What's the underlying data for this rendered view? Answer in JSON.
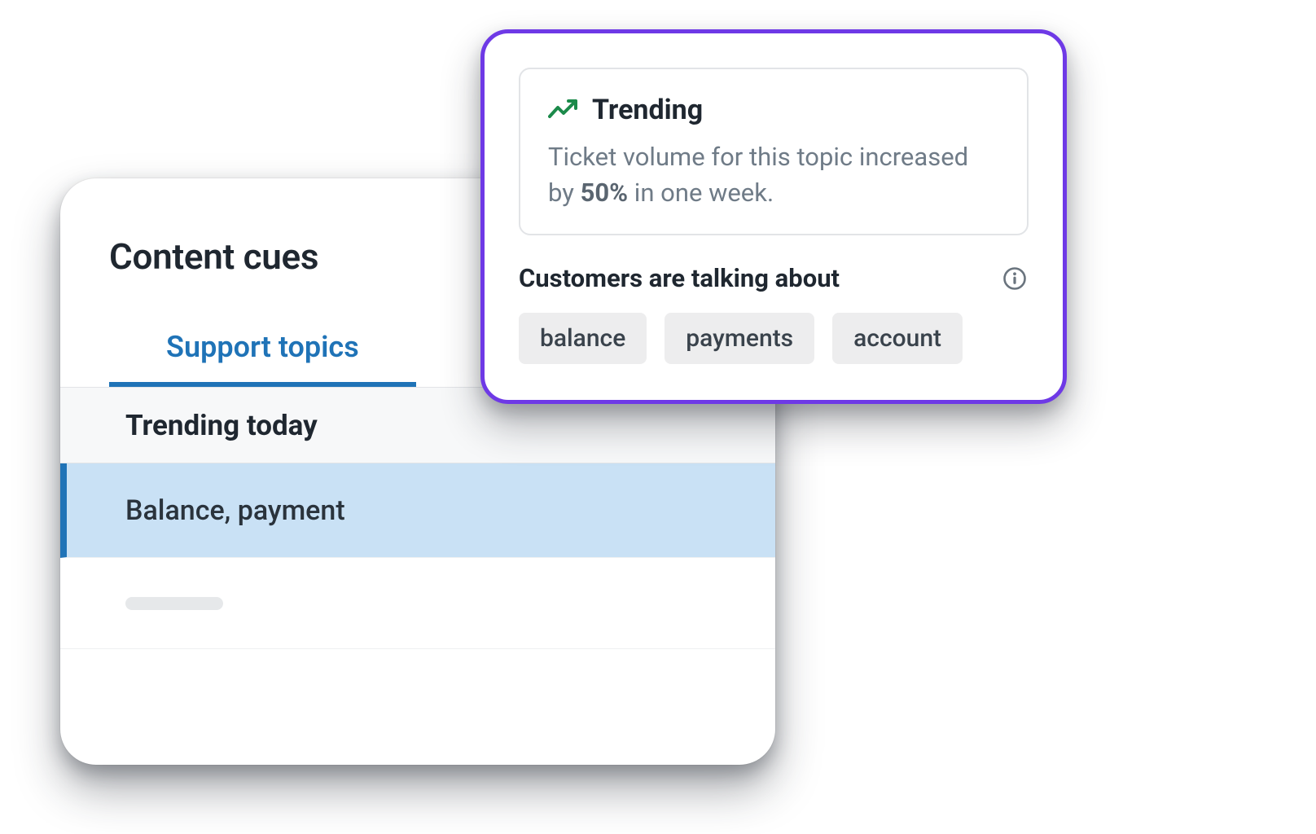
{
  "card": {
    "title": "Content cues",
    "tab_label": "Support topics",
    "section_label": "Trending today",
    "rows": [
      {
        "label": "Balance, payment",
        "selected": true
      }
    ]
  },
  "popover": {
    "trending_label": "Trending",
    "trending_body_pre": "Ticket volume for this topic increased by ",
    "trending_body_strong": "50%",
    "trending_body_post": " in one week.",
    "talking_heading": "Customers are talking about",
    "pills": [
      "balance",
      "payments",
      "account"
    ]
  }
}
